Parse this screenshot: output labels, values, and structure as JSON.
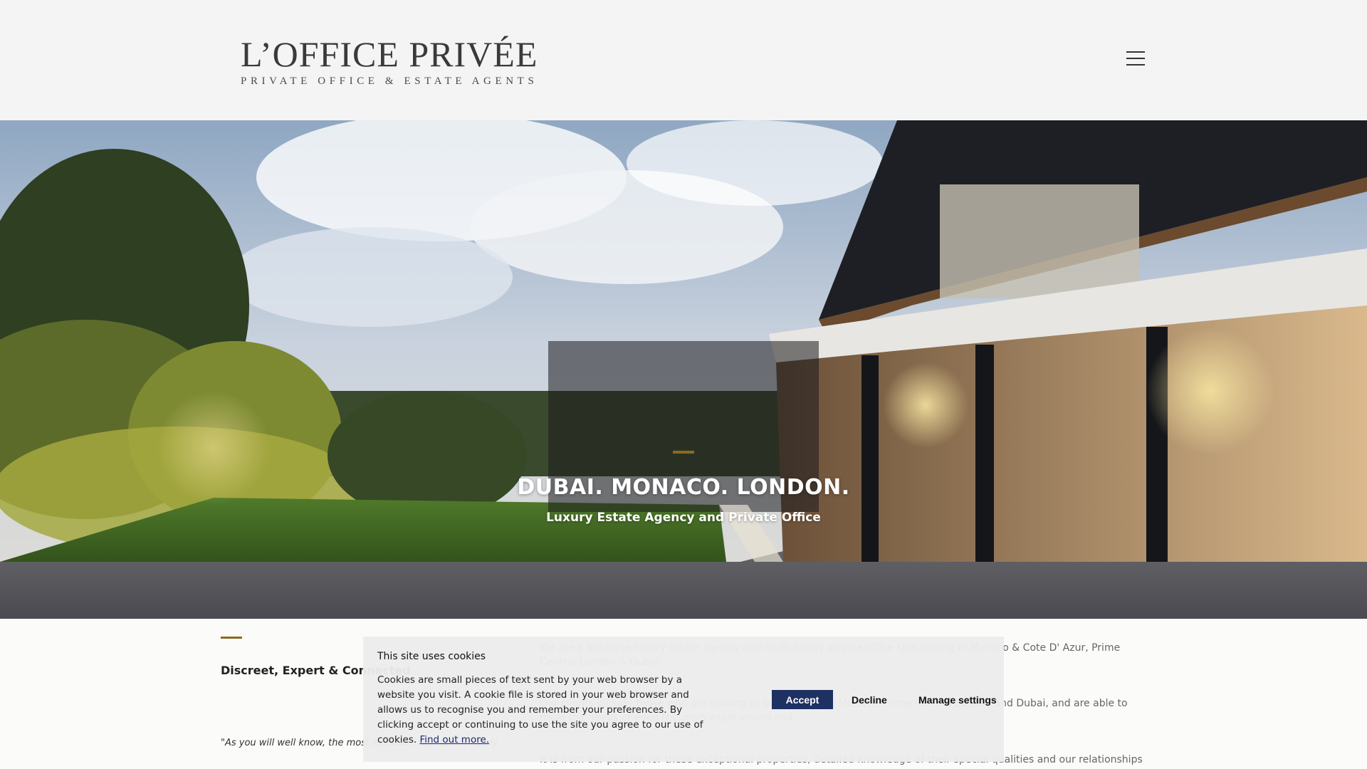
{
  "header": {
    "logo_main": "L’OFFICE PRIVÉE",
    "logo_sub": "PRIVATE OFFICE & ESTATE AGENTS",
    "menu_icon": "hamburger-menu-icon"
  },
  "hero": {
    "title": "DUBAI.  MONACO.  LONDON.",
    "subtitle": "Luxury Estate Agency and Private Office",
    "accent_color": "#8b6a1f"
  },
  "content": {
    "heading": "Discreet, Expert & Connected",
    "quote": "\"As you will well know, the most exclusive homes are rarely",
    "paragraph_1": "We are a boutique luxury estate agency and multi-family private office specialising in Monaco & Cote D' Azur, Prime Central London & Dubai.",
    "paragraph_2": "Our clients include those who are looking to buy and sell in Monaco, Prime Central London and Dubai, and are able to meet the needs of even the most experienced and",
    "paragraph_3": "It is from our passion for these exceptional properties, detailed knowledge of their special qualities and our relationships with"
  },
  "cookie_banner": {
    "title": "This site uses cookies",
    "text": "Cookies are small pieces of text sent by your web browser by a website you visit. A cookie file is stored in your web browser and allows us to recognise you and remember your preferences. By clicking accept or continuing to use the site you agree to our use of cookies.",
    "link_label": "Find out more.",
    "accept_label": "Accept",
    "decline_label": "Decline",
    "manage_label": "Manage settings",
    "accept_color": "#1e3163"
  }
}
